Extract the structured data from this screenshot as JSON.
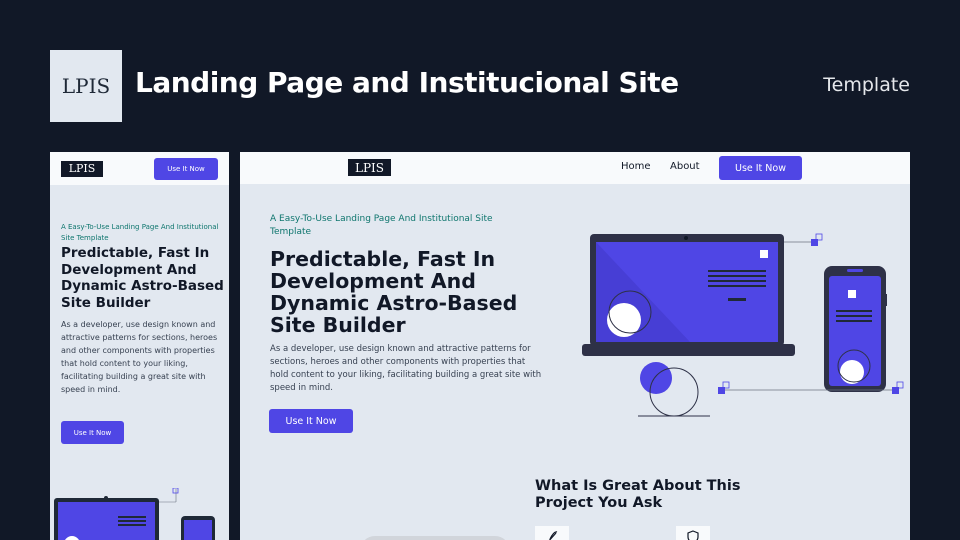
{
  "banner": {
    "logo_text": "LPIS",
    "title": "Landing Page and Institucional Site",
    "tag": "Template"
  },
  "site": {
    "logo_text": "LPIS",
    "nav": {
      "home": "Home",
      "about": "About",
      "cta": "Use It Now"
    },
    "hero": {
      "eyebrow": "A Easy-To-Use Landing Page And Institutional Site Template",
      "title": "Predictable, Fast In Development And Dynamic Astro-Based Site Builder",
      "body": "As a developer, use design known and attractive patterns for sections, heroes and other components with properties that hold content to your liking, facilitating building a great site with speed in mind.",
      "cta": "Use It Now"
    },
    "features": {
      "title": "What Is Great About This Project You Ask"
    }
  },
  "colors": {
    "background": "#111827",
    "accent": "#4f46e5",
    "preview_bg": "#e2e8f0",
    "header_bg": "#f8fafc",
    "eyebrow": "#0f766e"
  }
}
